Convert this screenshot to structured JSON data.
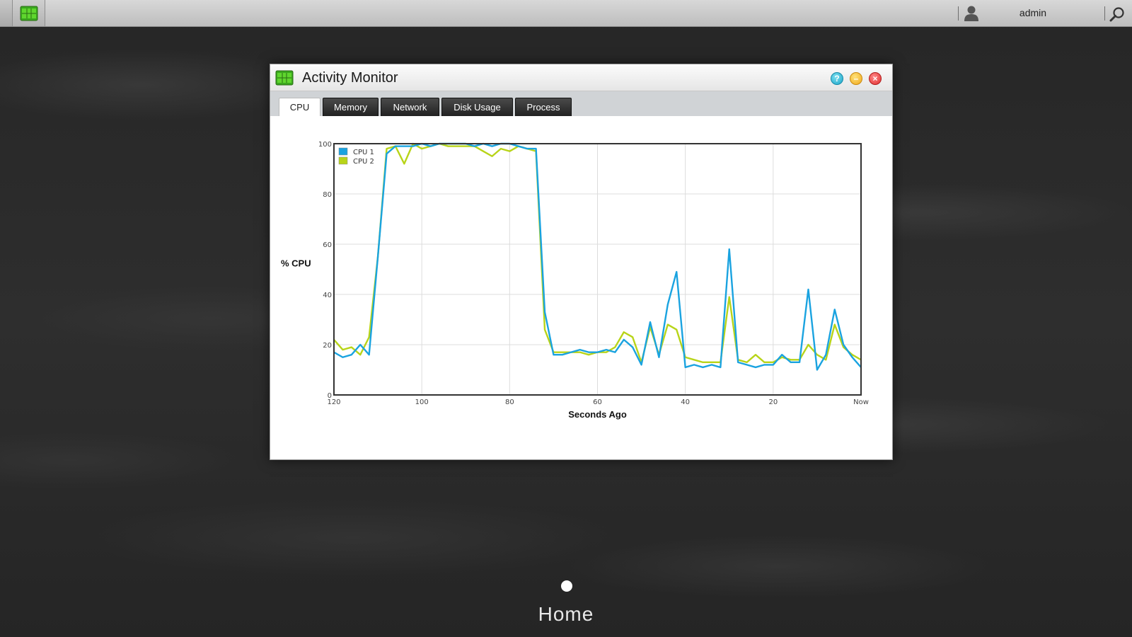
{
  "topbar": {
    "username": "admin",
    "user_icon": "user-icon",
    "search_icon": "search-icon",
    "app_icon": "activity-monitor-icon"
  },
  "window": {
    "title": "Activity Monitor",
    "controls": [
      "help-icon",
      "minimize-icon",
      "close-icon"
    ],
    "tabs": [
      {
        "label": "CPU",
        "active": true
      },
      {
        "label": "Memory",
        "active": false
      },
      {
        "label": "Network",
        "active": false
      },
      {
        "label": "Disk Usage",
        "active": false
      },
      {
        "label": "Process",
        "active": false
      }
    ]
  },
  "chart_data": {
    "type": "line",
    "title": "",
    "xlabel": "Seconds Ago",
    "ylabel": "% CPU",
    "xlim": [
      120,
      0
    ],
    "ylim": [
      0,
      100
    ],
    "x_ticks": [
      "120",
      "100",
      "80",
      "60",
      "40",
      "20",
      "Now"
    ],
    "y_ticks": [
      "0",
      "20",
      "40",
      "60",
      "80",
      "100"
    ],
    "grid": true,
    "legend_position": "top-left",
    "x": [
      120,
      118,
      116,
      114,
      112,
      110,
      108,
      106,
      104,
      102,
      100,
      98,
      96,
      94,
      92,
      90,
      88,
      86,
      84,
      82,
      80,
      78,
      76,
      74,
      72,
      70,
      68,
      66,
      64,
      62,
      60,
      58,
      56,
      54,
      52,
      50,
      48,
      46,
      44,
      42,
      40,
      38,
      36,
      34,
      32,
      30,
      28,
      26,
      24,
      22,
      20,
      18,
      16,
      14,
      12,
      10,
      8,
      6,
      4,
      2,
      0
    ],
    "series": [
      {
        "name": "CPU 1",
        "color": "#1aa3e0",
        "values": [
          17,
          15,
          16,
          20,
          16,
          55,
          96,
          99,
          99,
          99,
          100,
          99,
          100,
          100,
          100,
          100,
          99,
          100,
          99,
          100,
          100,
          99,
          98,
          98,
          33,
          16,
          16,
          17,
          18,
          17,
          17,
          18,
          17,
          22,
          19,
          12,
          29,
          15,
          36,
          49,
          11,
          12,
          11,
          12,
          11,
          58,
          13,
          12,
          11,
          12,
          12,
          16,
          13,
          13,
          42,
          10,
          16,
          34,
          20,
          15,
          11
        ]
      },
      {
        "name": "CPU 2",
        "color": "#b8d418",
        "values": [
          22,
          18,
          19,
          16,
          23,
          55,
          98,
          99,
          92,
          100,
          98,
          99,
          100,
          99,
          99,
          99,
          99,
          97,
          95,
          98,
          97,
          99,
          98,
          97,
          26,
          17,
          17,
          17,
          17,
          16,
          17,
          17,
          19,
          25,
          23,
          13,
          27,
          16,
          28,
          26,
          15,
          14,
          13,
          13,
          13,
          39,
          14,
          13,
          16,
          13,
          13,
          15,
          14,
          14,
          20,
          16,
          14,
          28,
          19,
          16,
          14
        ]
      }
    ]
  },
  "dock": {
    "page_label": "Home"
  }
}
